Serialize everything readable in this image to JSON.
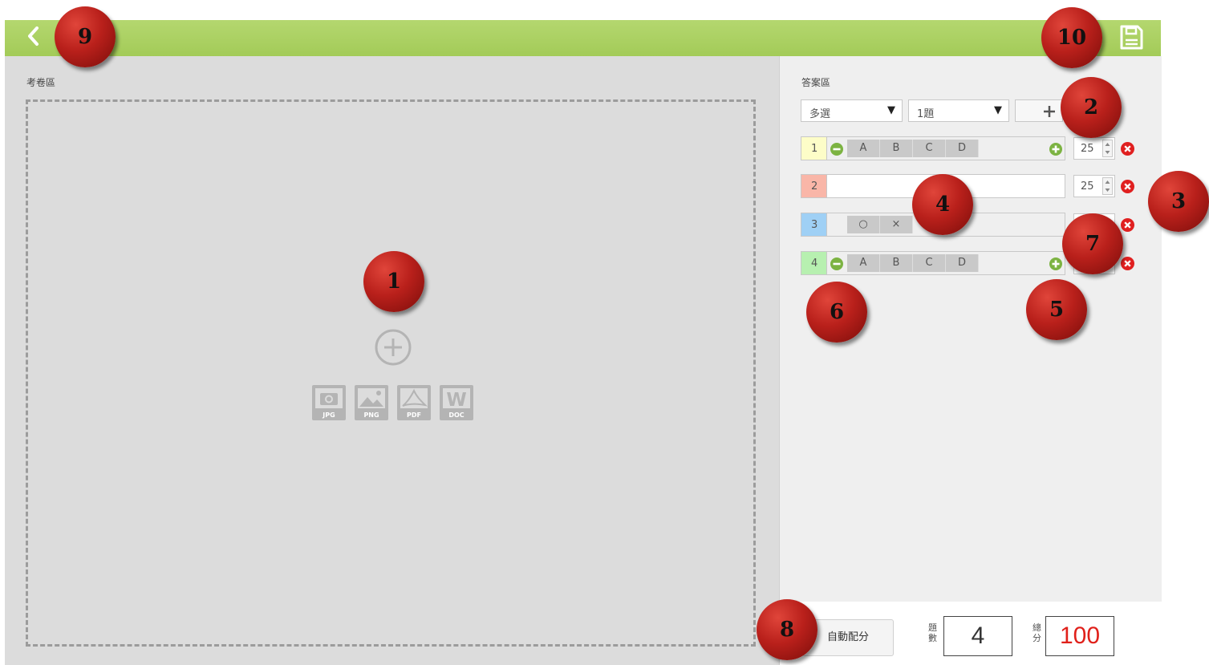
{
  "header": {
    "back_icon": "chevron-left-icon",
    "save_icon": "floppy-disk-icon",
    "background": "#a7cd5c"
  },
  "exam_area": {
    "label": "考卷區",
    "upload_icon": "plus-circle-icon",
    "file_types": [
      "JPG",
      "PNG",
      "PDF",
      "DOC"
    ]
  },
  "answer_area": {
    "label": "答案區",
    "type_select": "多選",
    "count_select": "1題",
    "add_icon": "plus-icon",
    "questions": [
      {
        "num": "1",
        "color": "#fdfdc8",
        "kind": "choice",
        "options": [
          "A",
          "B",
          "C",
          "D"
        ],
        "score": "25"
      },
      {
        "num": "2",
        "color": "#f9b6a8",
        "kind": "text",
        "options": [],
        "score": "25"
      },
      {
        "num": "3",
        "color": "#9fd0f5",
        "kind": "truefalse",
        "options": [
          "○",
          "×"
        ],
        "score": ""
      },
      {
        "num": "4",
        "color": "#b7f0b0",
        "kind": "choice",
        "options": [
          "A",
          "B",
          "C",
          "D"
        ],
        "score": ""
      }
    ]
  },
  "footer": {
    "auto_assign_label": "自動配分",
    "count_label": "題數",
    "count_label_chars": [
      "題",
      "數"
    ],
    "count_value": "4",
    "total_label": "總分",
    "total_label_chars": [
      "總",
      "分"
    ],
    "total_value": "100",
    "total_color": "#e0201a"
  },
  "callouts": [
    "1",
    "2",
    "3",
    "4",
    "5",
    "6",
    "7",
    "8",
    "9",
    "10"
  ],
  "colors": {
    "accent_green": "#7cb342",
    "delete_red": "#e02020",
    "callout_red": "#b9201b"
  }
}
